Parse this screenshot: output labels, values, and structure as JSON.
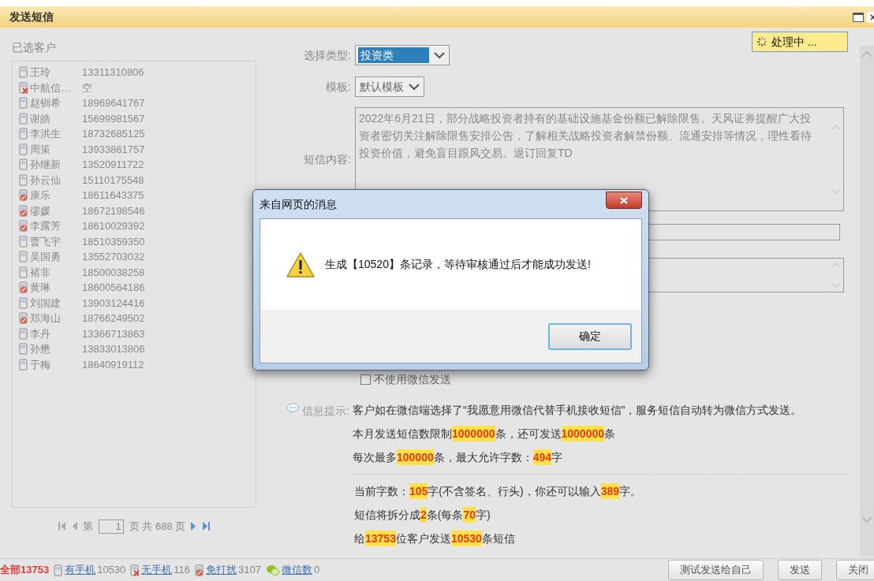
{
  "window": {
    "title": "发送短信"
  },
  "processing": {
    "text": "处理中 ..."
  },
  "customers": {
    "label": "已选客户",
    "items": [
      {
        "name": "王玲",
        "phone": "13311310806",
        "kind": "phone"
      },
      {
        "name": "中航信…",
        "phone": "空",
        "kind": "no_phone"
      },
      {
        "name": "赵钏希",
        "phone": "18969641767",
        "kind": "phone"
      },
      {
        "name": "谢皓",
        "phone": "15699981567",
        "kind": "phone"
      },
      {
        "name": "李洪生",
        "phone": "18732685125",
        "kind": "phone"
      },
      {
        "name": "周策",
        "phone": "13933861757",
        "kind": "phone"
      },
      {
        "name": "孙继新",
        "phone": "13520911722",
        "kind": "phone"
      },
      {
        "name": "孙云仙",
        "phone": "15110175548",
        "kind": "phone"
      },
      {
        "name": "康乐",
        "phone": "18611643375",
        "kind": "blocked"
      },
      {
        "name": "缪媛",
        "phone": "18672198546",
        "kind": "blocked"
      },
      {
        "name": "李露芳",
        "phone": "18610029392",
        "kind": "blocked"
      },
      {
        "name": "曹飞宇",
        "phone": "18510359350",
        "kind": "phone"
      },
      {
        "name": "吴国勇",
        "phone": "13552703032",
        "kind": "phone"
      },
      {
        "name": "褚非",
        "phone": "18500038258",
        "kind": "phone"
      },
      {
        "name": "黄琳",
        "phone": "18600564186",
        "kind": "blocked"
      },
      {
        "name": "刘国建",
        "phone": "13903124416",
        "kind": "phone"
      },
      {
        "name": "郑海山",
        "phone": "18766249502",
        "kind": "blocked"
      },
      {
        "name": "李丹",
        "phone": "13366713863",
        "kind": "phone"
      },
      {
        "name": "孙懋",
        "phone": "13833013806",
        "kind": "phone"
      },
      {
        "name": "于梅",
        "phone": "18640919112",
        "kind": "phone"
      }
    ],
    "pagination": {
      "prefix": "第",
      "page": "1",
      "suffix": "页 共 688 页"
    }
  },
  "form": {
    "type": {
      "label": "选择类型:",
      "value": "投资类"
    },
    "template": {
      "label": "模板:",
      "value": "默认模板"
    },
    "content": {
      "label": "短信内容:",
      "value": "2022年6月21日，部分战略投资者持有的基础设施基金份额已解除限售。天风证券提醒广大投资者密切关注解除限售安排公告，了解相关战略投资者解禁份额、流通安排等情况，理性看待投资价值，避免盲目跟风交易。退订回复TD"
    },
    "wechat_option": {
      "label": "不使用微信发送",
      "checked": false
    }
  },
  "info": {
    "label": "信息提示:",
    "lines": [
      "客户如在微信端选择了“我愿意用微信代替手机接收短信”，服务短信自动转为微信方式发送。",
      "本月发送短信数限制**1000000**条，还可发送**1000000**条",
      "每次最多**100000**条，最大允许字数：**494**字"
    ],
    "stats": [
      "当前字数：**105**字(不含签名、行头)，你还可以输入**389**字。",
      "短信将拆分成**2**条(每条**70**字)",
      "给**13753**位客户发送**10530**条短信"
    ]
  },
  "footer": {
    "summary": "全部13753",
    "filters": [
      {
        "label": "有手机",
        "count": "10530",
        "kind": "phone"
      },
      {
        "label": "无手机",
        "count": "116",
        "kind": "no_phone"
      },
      {
        "label": "免打扰",
        "count": "3107",
        "kind": "blocked"
      },
      {
        "label": "微信数",
        "count": "0",
        "kind": "wechat"
      }
    ],
    "buttons": [
      "测试发送给自己",
      "发送",
      "关闭"
    ]
  },
  "dialog": {
    "title": "来自网页的消息",
    "message": "生成【10520】条记录，等待审核通过后才能成功发送!",
    "button": "确定"
  }
}
